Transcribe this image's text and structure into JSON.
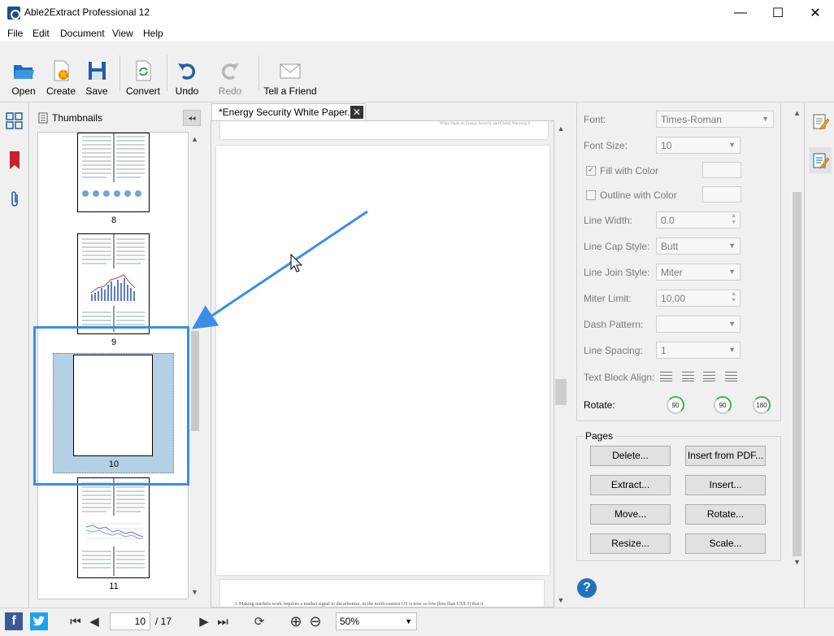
{
  "window": {
    "title": "Able2Extract Professional 12",
    "minimize_glyph": "—",
    "maximize_glyph": "☐",
    "close_glyph": "✕"
  },
  "menu": [
    "File",
    "Edit",
    "Document",
    "View",
    "Help"
  ],
  "toolbar": {
    "open": "Open",
    "create": "Create",
    "save": "Save",
    "convert": "Convert",
    "undo": "Undo",
    "redo": "Redo",
    "tell_a_friend": "Tell a Friend"
  },
  "thumbnails": {
    "tab_label": "Thumbnails",
    "collapse_glyph": "◂◂",
    "pages": [
      "8",
      "9",
      "10",
      "11"
    ],
    "selected_page": "10"
  },
  "document": {
    "tab_label": "*Energy Security White Paper.pdf",
    "close_glyph": "✕",
    "top_page_header": "White Paper on Energy Security and Global Warming    9",
    "bottom_page_text": "3. Making markets work requires a market signal to decarbonize.      in the north-eastern US is now so low (less than US$ 3) that it"
  },
  "properties": {
    "font_label": "Font:",
    "font_value": "Times-Roman",
    "font_size_label": "Font Size:",
    "font_size_value": "10",
    "fill_label": "Fill with Color",
    "fill_checked": "✓",
    "outline_label": "Outline with Color",
    "line_width_label": "Line Width:",
    "line_width_value": "0.0",
    "line_cap_label": "Line Cap Style:",
    "line_cap_value": "Butt",
    "line_join_label": "Line Join Style:",
    "line_join_value": "Miter",
    "miter_label": "Miter Limit:",
    "miter_value": "10.00",
    "dash_label": "Dash Pattern:",
    "dash_value": "",
    "spacing_label": "Line Spacing:",
    "spacing_value": "1",
    "align_label": "Text Block Align:",
    "rotate_label": "Rotate:",
    "rotate_values": [
      "90",
      "90",
      "180"
    ]
  },
  "pages_group": {
    "title": "Pages",
    "buttons": [
      "Delete...",
      "Insert from PDF...",
      "Extract...",
      "Insert...",
      "Move...",
      "Rotate...",
      "Resize...",
      "Scale..."
    ]
  },
  "help": "?",
  "status": {
    "current_page": "10",
    "total_pages": "/ 17",
    "zoom": "50%"
  },
  "colors": {
    "accent": "#3a8ee6",
    "selection": "#b4d0e4",
    "rotate_green": "#3bb54a"
  }
}
